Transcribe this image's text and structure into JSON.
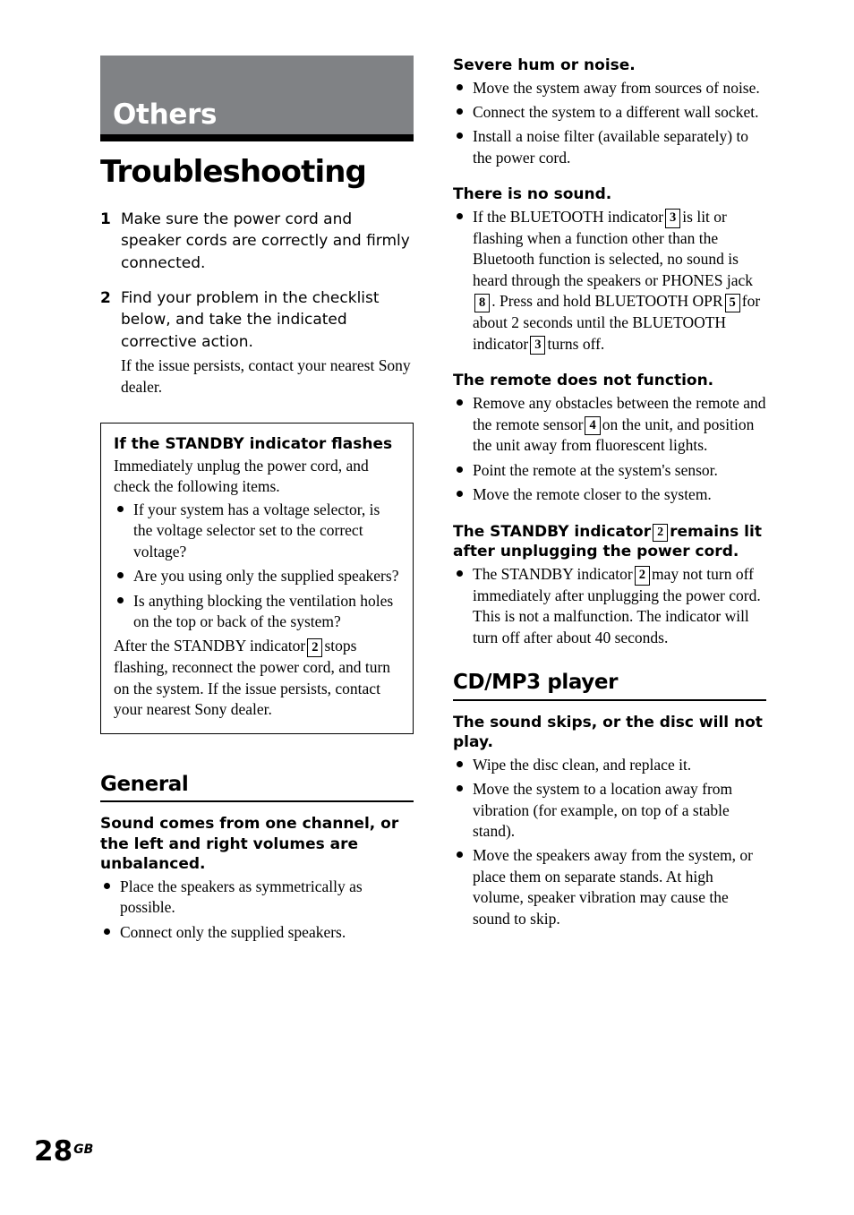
{
  "banner": {
    "label": "Others"
  },
  "title": "Troubleshooting",
  "steps": [
    {
      "num": "1",
      "text": "Make sure the power cord and speaker cords are correctly and firmly connected.",
      "sub": ""
    },
    {
      "num": "2",
      "text": "Find your problem in the checklist below, and take the indicated corrective action.",
      "sub": "If the issue persists, contact your nearest Sony dealer."
    }
  ],
  "callout": {
    "title": "If the STANDBY indicator flashes",
    "intro": "Immediately unplug the power cord, and check the following items.",
    "bullets": [
      "If your system has a voltage selector, is the voltage selector set to the correct voltage?",
      "Are you using only the supplied speakers?",
      "Is anything blocking the ventilation holes on the top or back of the system?"
    ],
    "outro_before": "After the STANDBY indicator",
    "outro_marker": "2",
    "outro_after": "stops flashing, reconnect the power cord, and turn on the system. If the issue persists, contact your nearest Sony dealer."
  },
  "sections": {
    "general": {
      "heading": "General",
      "problems": [
        {
          "heading": "Sound comes from one channel, or the left and right volumes are unbalanced.",
          "bullets": [
            "Place the speakers as symmetrically as possible.",
            "Connect only the supplied speakers."
          ]
        }
      ]
    },
    "cd_mp3": {
      "heading": "CD/MP3 player",
      "problems": [
        {
          "heading": "The sound skips, or the disc will not play.",
          "bullets": [
            "Wipe the disc clean, and replace it.",
            "Move the system to a location away from vibration (for example, on top of a stable stand).",
            "Move the speakers away from the system, or place them on separate stands. At high volume, speaker vibration may cause the sound to skip."
          ]
        }
      ]
    }
  },
  "right_column": {
    "hum": {
      "heading": "Severe hum or noise.",
      "bullets": [
        "Move the system away from sources of noise.",
        "Connect the system to a different wall socket.",
        "Install a noise filter (available separately) to the power cord."
      ]
    },
    "no_sound": {
      "heading": "There is no sound.",
      "bullet_parts": {
        "p1": "If the BLUETOOTH indicator",
        "m1": "3",
        "p2": "is lit or flashing when a function other than the Bluetooth function is selected, no sound is heard through the speakers or PHONES jack",
        "m2": "8",
        "p3": ". Press and hold BLUETOOTH OPR",
        "m3": "5",
        "p4": "for about 2 seconds until the BLUETOOTH indicator",
        "m4": "3",
        "p5": "turns off."
      }
    },
    "remote": {
      "heading": "The remote does not function.",
      "bullet1_parts": {
        "p1": "Remove any obstacles between the remote and the remote sensor",
        "m1": "4",
        "p2": "on the unit, and position the unit away from fluorescent lights."
      },
      "bullets": [
        "Point the remote at the system's sensor.",
        "Move the remote closer to the system."
      ]
    },
    "standby": {
      "heading_parts": {
        "p1": "The STANDBY indicator",
        "m1": "2",
        "p2": "remains lit after unplugging the power cord."
      },
      "bullet_parts": {
        "p1": "The STANDBY indicator",
        "m1": "2",
        "p2": "may not turn off immediately after unplugging the power cord. This is not a malfunction. The indicator will turn off after about 40 seconds."
      }
    }
  },
  "folio": {
    "number": "28",
    "suffix": "GB"
  }
}
